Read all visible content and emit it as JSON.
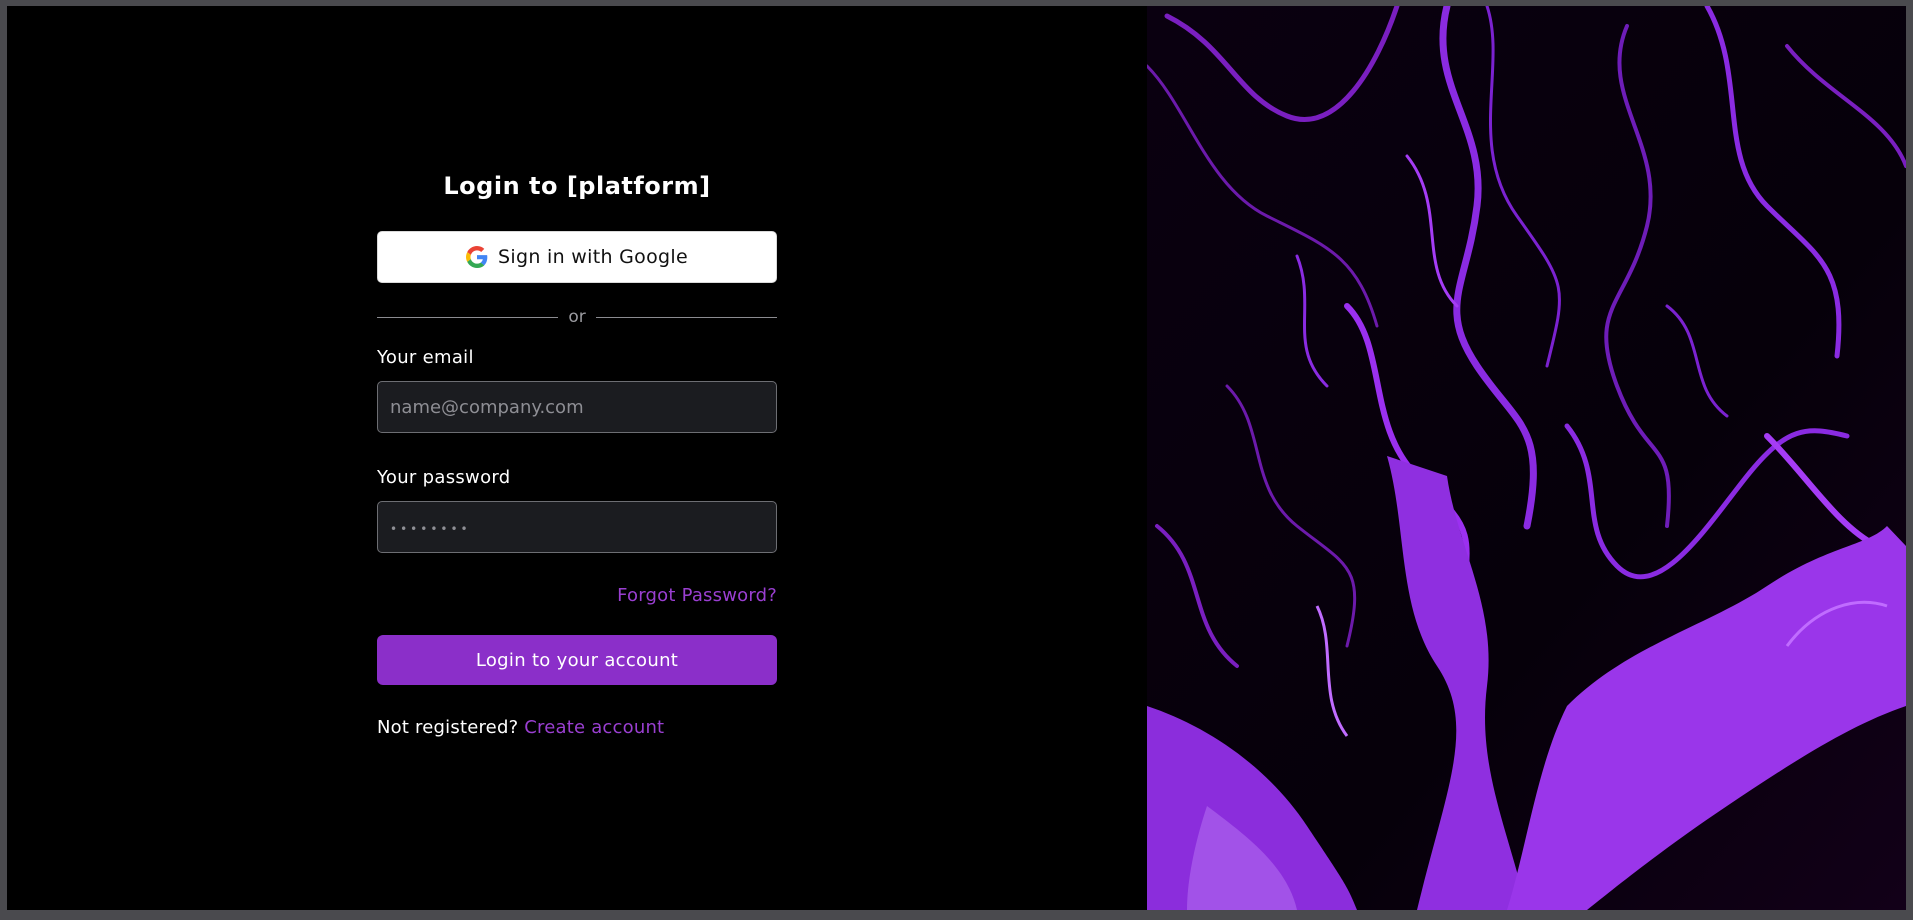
{
  "login": {
    "title": "Login to [platform]",
    "google_button_label": "Sign in with Google",
    "divider_text": "or",
    "email_label": "Your email",
    "email_placeholder": "name@company.com",
    "password_label": "Your password",
    "password_placeholder": "••••••••",
    "forgot_password_label": "Forgot Password?",
    "submit_label": "Login to your account",
    "register_prompt": "Not registered?",
    "register_link_label": "Create account"
  },
  "theme": {
    "accent": "#8b2fc9",
    "link": "#9a3fd1",
    "background": "#000000",
    "input_background": "#1b1c20"
  },
  "icons": {
    "google": "google-g-icon"
  },
  "decor": {
    "side_image": "purple-fluid-marble-art"
  }
}
